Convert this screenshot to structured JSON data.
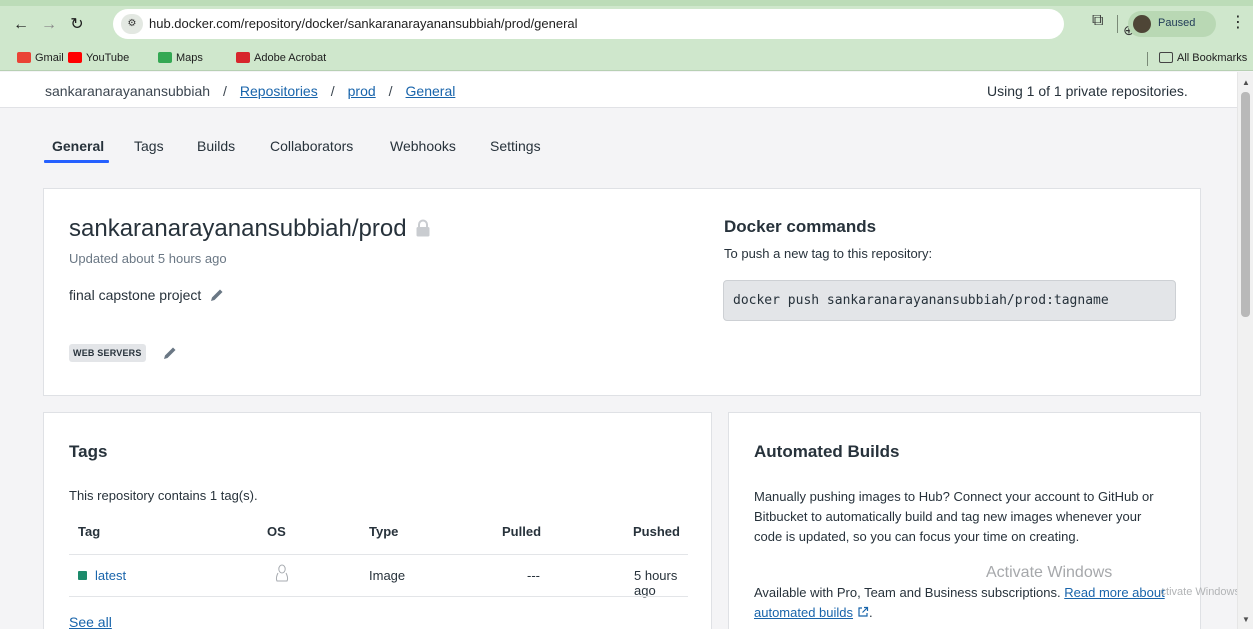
{
  "browser": {
    "url": "hub.docker.com/repository/docker/sankaranarayanansubbiah/prod/general",
    "profile_status": "Paused",
    "bookmarks": [
      {
        "label": "Gmail",
        "color": "#ea4335"
      },
      {
        "label": "YouTube",
        "color": "#ff0000"
      },
      {
        "label": "Maps",
        "color": "#34a853"
      },
      {
        "label": "Adobe Acrobat",
        "color": "#d7262c"
      }
    ],
    "all_bookmarks": "All Bookmarks"
  },
  "breadcrumb": {
    "owner": "sankaranarayanansubbiah",
    "sep": "/",
    "repositories": "Repositories",
    "repo": "prod",
    "page": "General"
  },
  "usage_text": "Using 1 of 1 private repositories.",
  "tabs": [
    "General",
    "Tags",
    "Builds",
    "Collaborators",
    "Webhooks",
    "Settings"
  ],
  "active_tab": "General",
  "repo": {
    "name": "sankaranarayanansubbiah/prod",
    "updated": "Updated about 5 hours ago",
    "description": "final capstone project",
    "category": "WEB SERVERS"
  },
  "docker_commands": {
    "title": "Docker commands",
    "subtitle": "To push a new tag to this repository:",
    "command": "docker push sankaranarayanansubbiah/prod:tagname"
  },
  "tags_card": {
    "title": "Tags",
    "count_text": "This repository contains 1 tag(s).",
    "columns": [
      "Tag",
      "OS",
      "Type",
      "Pulled",
      "Pushed"
    ],
    "rows": [
      {
        "tag": "latest",
        "os": "linux-icon",
        "type": "Image",
        "pulled": "---",
        "pushed": "5 hours ago"
      }
    ],
    "see_all": "See all"
  },
  "builds_card": {
    "title": "Automated Builds",
    "paragraph1": "Manually pushing images to Hub? Connect your account to GitHub or Bitbucket to automatically build and tag new images whenever your code is updated, so you can focus your time on creating.",
    "paragraph2_prefix": "Available with Pro, Team and Business subscriptions. ",
    "link_text": "Read more about automated builds"
  },
  "watermark": {
    "line1": "Activate Windows",
    "line2": "Go to Settings to activate Windows."
  },
  "colors": {
    "accent": "#2560ff",
    "link": "#1864ab",
    "tag_status": "#1c8a6b",
    "browser_frame": "#cfe7cc"
  }
}
